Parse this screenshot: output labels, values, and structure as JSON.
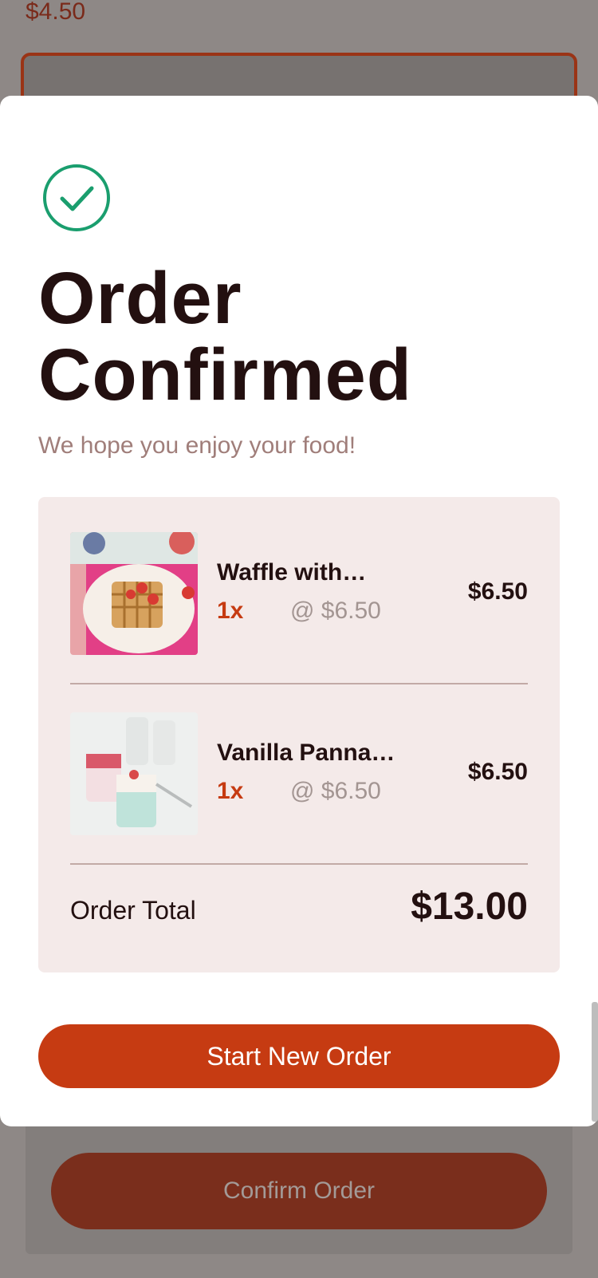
{
  "background": {
    "price": "$4.50",
    "confirm_label": "Confirm Order"
  },
  "modal": {
    "title": "Order Confirmed",
    "subtitle": "We hope you enjoy your food!",
    "items": [
      {
        "name": "Waffle with…",
        "qty": "1x",
        "unit_price": "@ $6.50",
        "total": "$6.50",
        "image": "waffle-photo"
      },
      {
        "name": "Vanilla Panna…",
        "qty": "1x",
        "unit_price": "@ $6.50",
        "total": "$6.50",
        "image": "panna-cotta-photo"
      }
    ],
    "total_label": "Order Total",
    "total_value": "$13.00",
    "button_label": "Start New Order"
  },
  "colors": {
    "accent": "#c63b12",
    "success": "#1a9e6e",
    "text": "#231010",
    "panel": "#f4eae9"
  }
}
